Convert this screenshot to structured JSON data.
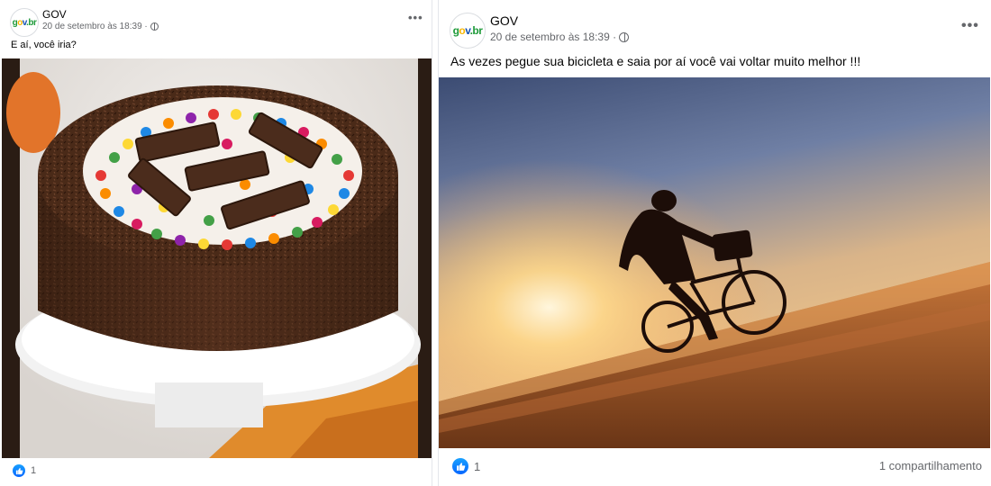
{
  "posts": [
    {
      "author": "GOV",
      "avatar_logo": "gov.br",
      "timestamp": "20 de setembro às 18:39 ·",
      "caption": "E aí, você iria?",
      "reaction_count": "1",
      "more_icon": "more-options-icon",
      "privacy_icon": "globe-icon",
      "image_subject": "chocolate-sprinkle-cake-with-candies"
    },
    {
      "author": "GOV",
      "avatar_logo": "gov.br",
      "timestamp": "20 de setembro às 18:39 ·",
      "caption": "As vezes pegue sua bicicleta e saia por aí você vai voltar muito melhor !!!",
      "reaction_count": "1",
      "shares": "1 compartilhamento",
      "more_icon": "more-options-icon",
      "privacy_icon": "globe-icon",
      "image_subject": "cyclist-on-beach-at-sunset"
    }
  ],
  "colors": {
    "facebook_blue": "#0866ff",
    "secondary_text": "#65676b",
    "primary_text": "#050505",
    "gov_green": "#1e9a3a",
    "gov_blue": "#1351b4",
    "gov_yellow": "#f7b500"
  }
}
